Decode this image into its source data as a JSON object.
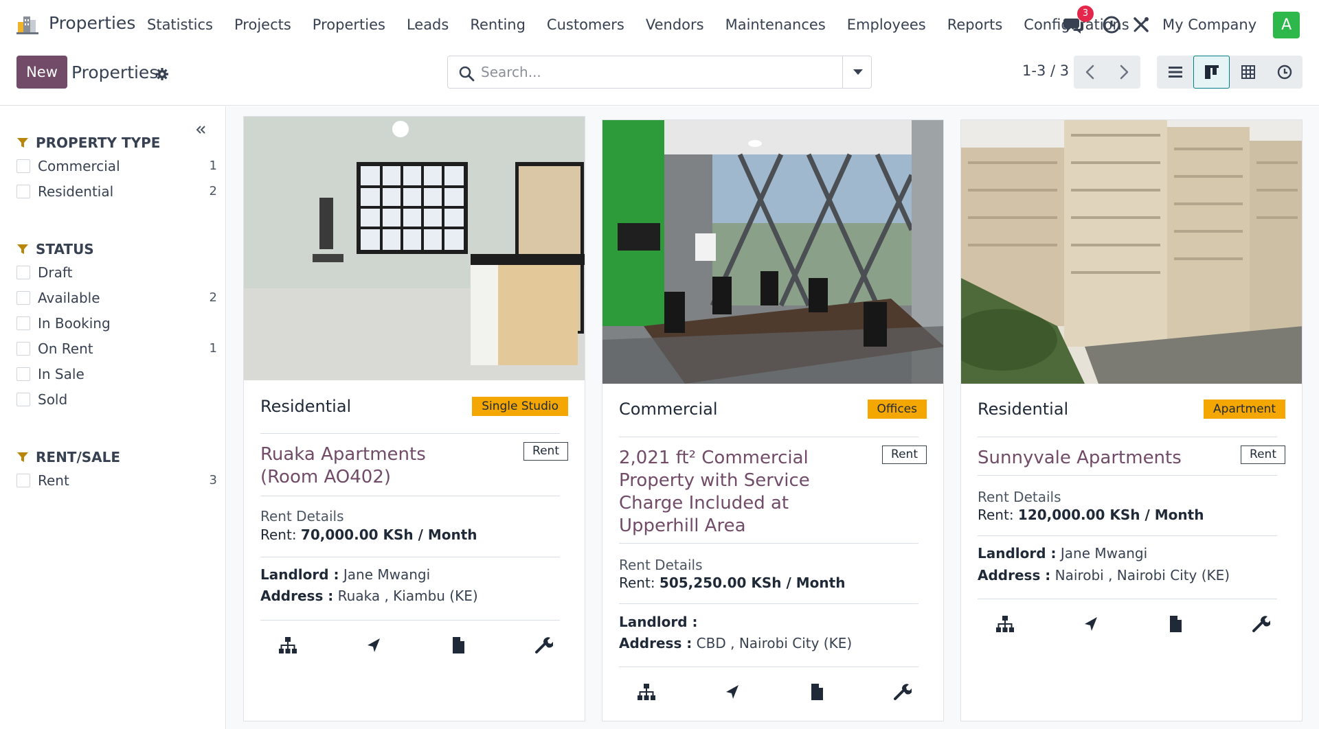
{
  "app": {
    "title": "Properties",
    "logo_icon": "building-icon",
    "menu": [
      "Statistics",
      "Projects",
      "Properties",
      "Leads",
      "Renting",
      "Customers",
      "Vendors",
      "Maintenances",
      "Employees",
      "Reports",
      "Configurations"
    ],
    "messages_badge": "3",
    "company": "My Company",
    "avatar_letter": "A",
    "colors": {
      "brand": "#714b67",
      "accent": "#017e84",
      "badge": "#e4264a",
      "avatar": "#2eb84b",
      "tag": "#f4a701"
    }
  },
  "control": {
    "new_label": "New",
    "title": "Properties",
    "search_placeholder": "Search...",
    "pager": "1-3 / 3",
    "views": [
      "list",
      "kanban",
      "pivot",
      "activity"
    ],
    "active_view": "kanban"
  },
  "sidebar": {
    "property_type": {
      "title": "PROPERTY TYPE",
      "items": [
        {
          "label": "Commercial",
          "count": "1"
        },
        {
          "label": "Residential",
          "count": "2"
        }
      ]
    },
    "status": {
      "title": "STATUS",
      "items": [
        {
          "label": "Draft",
          "count": ""
        },
        {
          "label": "Available",
          "count": "2"
        },
        {
          "label": "In Booking",
          "count": ""
        },
        {
          "label": "On Rent",
          "count": "1"
        },
        {
          "label": "In Sale",
          "count": ""
        },
        {
          "label": "Sold",
          "count": ""
        }
      ]
    },
    "rent_sale": {
      "title": "RENT/SALE",
      "items": [
        {
          "label": "Rent",
          "count": "3"
        }
      ]
    }
  },
  "cards": [
    {
      "category": "Residential",
      "tag": "Single Studio",
      "name": "Ruaka Apartments (Room AO402)",
      "mode": "Rent",
      "rent_details_label": "Rent Details",
      "rent_prefix": "Rent:",
      "rent_amount": "70,000.00 KSh / Month",
      "landlord_label": "Landlord :",
      "landlord": "Jane Mwangi",
      "address_label": "Address :",
      "address": "Ruaka , Kiambu (KE)",
      "image": "studio-interior-photo"
    },
    {
      "category": "Commercial",
      "tag": "Offices",
      "name": "2,021 ft² Commercial Property with Service Charge Included at Upperhill Area",
      "mode": "Rent",
      "rent_details_label": "Rent Details",
      "rent_prefix": "Rent:",
      "rent_amount": "505,250.00 KSh / Month",
      "landlord_label": "Landlord :",
      "landlord": "",
      "address_label": "Address :",
      "address": "CBD , Nairobi City (KE)",
      "image": "office-boardroom-photo"
    },
    {
      "category": "Residential",
      "tag": "Apartment",
      "name": "Sunnyvale Apartments",
      "mode": "Rent",
      "rent_details_label": "Rent Details",
      "rent_prefix": "Rent:",
      "rent_amount": "120,000.00 KSh / Month",
      "landlord_label": "Landlord :",
      "landlord": "Jane Mwangi",
      "address_label": "Address :",
      "address": "Nairobi , Nairobi City (KE)",
      "image": "apartment-building-photo"
    }
  ]
}
